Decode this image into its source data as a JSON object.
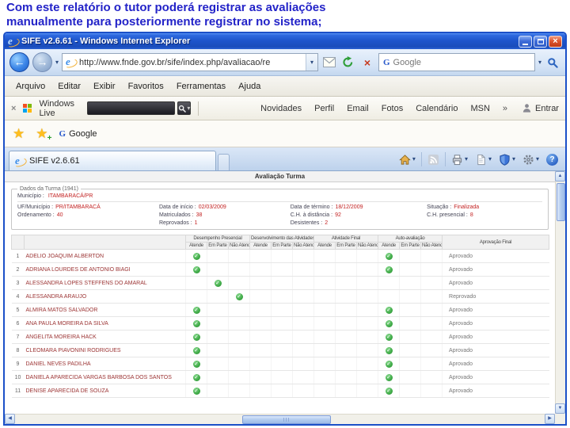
{
  "caption": {
    "line1": "Com este relatório o tutor poderá registrar as avaliações",
    "line2": "manualmente para posteriormente registrar no sistema;"
  },
  "window": {
    "title": "SIFE v2.6.61 - Windows Internet Explorer"
  },
  "nav": {
    "url": "http://www.fnde.gov.br/sife/index.php/avaliacao/re",
    "search_value": "Google"
  },
  "menu": {
    "items": [
      "Arquivo",
      "Editar",
      "Exibir",
      "Favoritos",
      "Ferramentas",
      "Ajuda"
    ]
  },
  "live": {
    "brand": "Windows Live",
    "links": [
      "Novidades",
      "Perfil",
      "Email",
      "Fotos",
      "Calendário",
      "MSN"
    ],
    "overflow": "»",
    "sign_in": "Entrar"
  },
  "favorites": {
    "google_label": "Google"
  },
  "tabs": {
    "active": "SIFE v2.6.61"
  },
  "icons": {
    "back": "←",
    "forward": "→",
    "caret": "▾",
    "stop": "×",
    "close": "×",
    "live_close": "×",
    "star": "★",
    "plus": "+",
    "check": "✓",
    "chevron": "»",
    "help": "?",
    "e": "e",
    "g": "G",
    "up": "▲",
    "down": "▼",
    "left": "◀",
    "right": "▶"
  },
  "page": {
    "title": "Avaliação Turma",
    "turma": {
      "legend": "Dados da Turma (1941)",
      "municipio_label": "Município :",
      "municipio_value": "ITAMBARACÁ/PR",
      "fields": [
        [
          {
            "label": "UF/Município :",
            "value": "PR/ITAMBARACÁ"
          },
          {
            "label": "Data de início :",
            "value": "02/03/2009"
          },
          {
            "label": "Data de término :",
            "value": "18/12/2009"
          },
          {
            "label": "Situação :",
            "value": "Finalizada"
          }
        ],
        [
          {
            "label": "Ordenamento :",
            "value": "40"
          },
          {
            "label": "Matriculados :",
            "value": "38"
          },
          {
            "label": "C.H. à distância :",
            "value": "92"
          },
          {
            "label": "C.H. presencial :",
            "value": "8"
          }
        ],
        [
          {
            "label": "",
            "value": ""
          },
          {
            "label": "Reprovados :",
            "value": "1"
          },
          {
            "label": "Desistentes :",
            "value": "2"
          },
          {
            "label": "",
            "value": ""
          }
        ]
      ]
    },
    "table": {
      "groups": [
        "Desempenho Presencial",
        "Desenvolvimento das Atividades",
        "Atividade Final",
        "Auto-avaliação"
      ],
      "subheaders": [
        "Atende",
        "Em Parte",
        "Não Atende"
      ],
      "final_header": "Aprovação Final",
      "rows": [
        {
          "num": 1,
          "name": "ADELIO JOAQUIM ALBERTON",
          "marks": {
            "presencial": "atende",
            "auto": "atende"
          },
          "final": "Aprovado"
        },
        {
          "num": 2,
          "name": "ADRIANA LOURDES DE ANTONIO BIAGI",
          "marks": {
            "presencial": "atende",
            "auto": "atende"
          },
          "final": "Aprovado"
        },
        {
          "num": 3,
          "name": "ALESSANDRA LOPES STEFFENS DO AMARAL",
          "marks": {
            "presencial": "em_parte"
          },
          "final": "Aprovado"
        },
        {
          "num": 4,
          "name": "ALESSANDRA ARAUJO",
          "marks": {
            "presencial": "nao_atende"
          },
          "final": "Reprovado"
        },
        {
          "num": 5,
          "name": "ALMIRA MATOS SALVADOR",
          "marks": {
            "presencial": "atende",
            "auto": "atende"
          },
          "final": "Aprovado"
        },
        {
          "num": 6,
          "name": "ANA PAULA MOREIRA DA SILVA",
          "marks": {
            "presencial": "atende",
            "auto": "atende"
          },
          "final": "Aprovado"
        },
        {
          "num": 7,
          "name": "ANGELITA MOREIRA HACK",
          "marks": {
            "presencial": "atende",
            "auto": "atende"
          },
          "final": "Aprovado"
        },
        {
          "num": 8,
          "name": "CLEOMARA PIAVONINI RODRIGUES",
          "marks": {
            "presencial": "atende",
            "auto": "atende"
          },
          "final": "Aprovado"
        },
        {
          "num": 9,
          "name": "DANIEL NEVES PADILHA",
          "marks": {
            "presencial": "atende",
            "auto": "atende"
          },
          "final": "Aprovado"
        },
        {
          "num": 10,
          "name": "DANIELA APARECIDA VARGAS BARBOSA DOS SANTOS",
          "marks": {
            "presencial": "atende",
            "auto": "atende"
          },
          "final": "Aprovado"
        },
        {
          "num": 11,
          "name": "DENISE APARECIDA DE SOUZA",
          "marks": {
            "presencial": "atende",
            "auto": "atende"
          },
          "final": "Aprovado"
        }
      ]
    }
  }
}
